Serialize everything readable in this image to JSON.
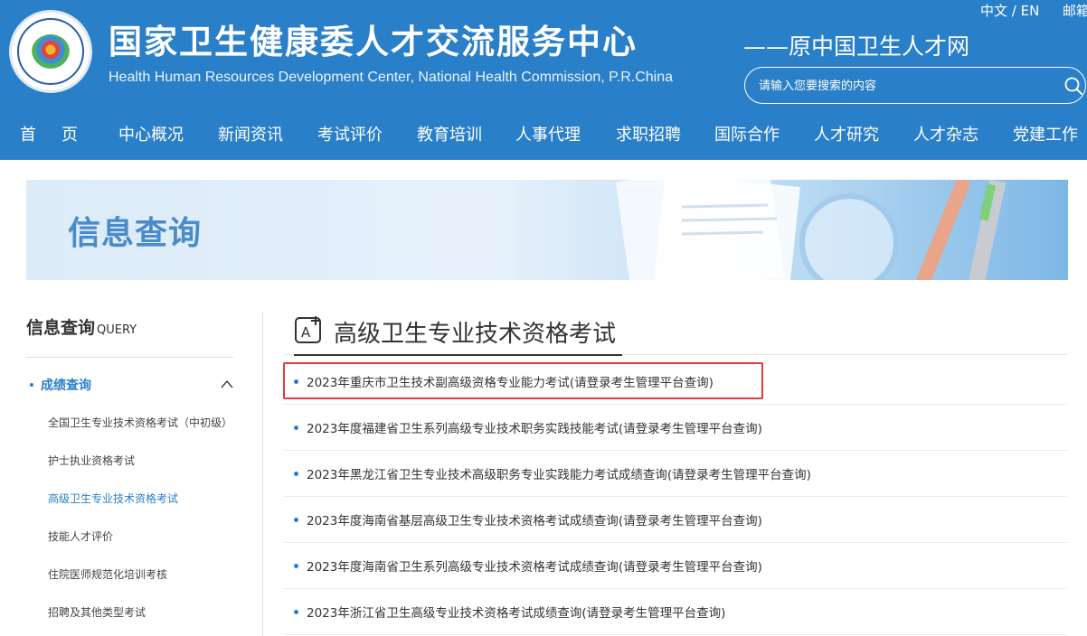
{
  "header": {
    "title_cn": "国家卫生健康委人才交流服务中心",
    "title_en": "Health Human Resources Development Center, National Health Commission, P.R.China",
    "subtitle": "——原中国卫生人才网",
    "lang": "中文 / EN",
    "mailbox": "邮箱",
    "search_placeholder": "请输入您要搜索的内容"
  },
  "nav": {
    "items": [
      "首页",
      "中心概况",
      "新闻资讯",
      "考试评价",
      "教育培训",
      "人事代理",
      "求职招聘",
      "国际合作",
      "人才研究",
      "人才杂志",
      "党建工作"
    ]
  },
  "banner": {
    "title": "信息查询"
  },
  "sidebar": {
    "title": "信息查询",
    "title_en": "QUERY",
    "category": "成绩查询",
    "items": [
      "全国卫生专业技术资格考试（中初级）",
      "护士执业资格考试",
      "高级卫生专业技术资格考试",
      "技能人才评价",
      "住院医师规范化培训考核",
      "招聘及其他类型考试"
    ]
  },
  "main": {
    "section_title": "高级卫生专业技术资格考试",
    "list": [
      "2023年重庆市卫生技术副高级资格专业能力考试(请登录考生管理平台查询)",
      "2023年度福建省卫生系列高级专业技术职务实践技能考试(请登录考生管理平台查询)",
      "2023年黑龙江省卫生专业技术高级职务专业实践能力考试成绩查询(请登录考生管理平台查询)",
      "2023年度海南省基层高级卫生专业技术资格考试成绩查询(请登录考生管理平台查询)",
      "2023年度海南省卫生系列高级专业技术资格考试成绩查询(请登录考生管理平台查询)",
      "2023年浙江省卫生高级专业技术资格考试成绩查询(请登录考生管理平台查询)"
    ]
  },
  "colors": {
    "brand_blue": "#2a7fc9",
    "highlight_red": "#e33a3a"
  }
}
